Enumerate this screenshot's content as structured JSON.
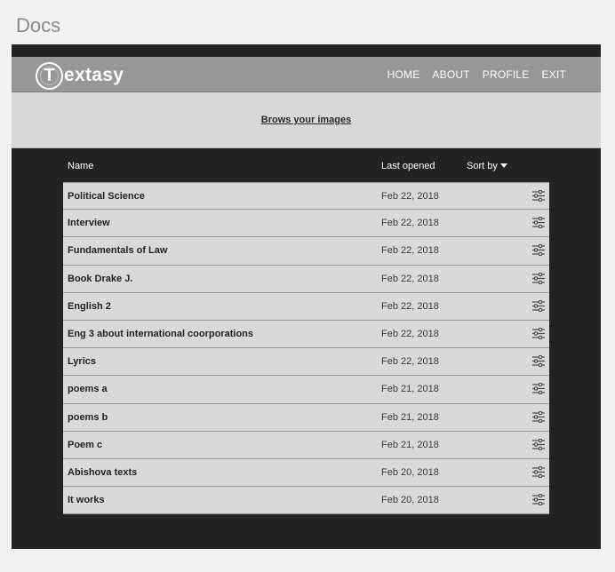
{
  "page": {
    "label": "Docs"
  },
  "header": {
    "logo_letter": "T",
    "logo_text": "extasy",
    "nav": [
      "HOME",
      "ABOUT",
      "PROFILE",
      "EXIT"
    ]
  },
  "upload": {
    "link_label": "Brows your images"
  },
  "table": {
    "columns": {
      "name": "Name",
      "last_opened": "Last opened",
      "sort": "Sort by"
    },
    "rows": [
      {
        "name": "Political Science",
        "date": "Feb 22, 2018"
      },
      {
        "name": "Interview",
        "date": "Feb 22, 2018"
      },
      {
        "name": "Fundamentals of Law",
        "date": "Feb 22, 2018"
      },
      {
        "name": "Book Drake J.",
        "date": "Feb 22, 2018"
      },
      {
        "name": "English 2",
        "date": "Feb 22, 2018"
      },
      {
        "name": "Eng 3 about international coorporations",
        "date": "Feb 22, 2018"
      },
      {
        "name": "Lyrics",
        "date": "Feb 22, 2018"
      },
      {
        "name": "poems a",
        "date": "Feb 21, 2018"
      },
      {
        "name": "poems b",
        "date": "Feb 21, 2018"
      },
      {
        "name": "Poem c",
        "date": "Feb 21, 2018"
      },
      {
        "name": "Abishova texts",
        "date": "Feb 20, 2018"
      },
      {
        "name": "It works",
        "date": "Feb 20, 2018"
      }
    ]
  },
  "icons": {
    "row_action": "sliders-icon",
    "sort": "caret-down-icon"
  },
  "colors": {
    "frame": "#232323",
    "header": "#979797",
    "panel": "#d8d8d8"
  }
}
